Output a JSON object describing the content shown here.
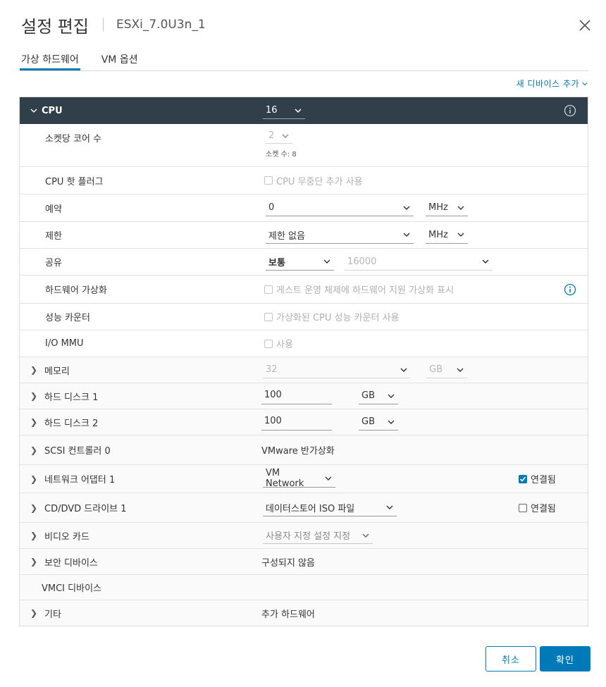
{
  "dialog": {
    "title": "설정 편집",
    "vm_name": "ESXi_7.0U3n_1"
  },
  "tabs": [
    {
      "label": "가상 하드웨어",
      "active": true
    },
    {
      "label": "VM 옵션",
      "active": false
    }
  ],
  "add_device": "새 디바이스 추가",
  "cpu": {
    "label": "CPU",
    "value": "16",
    "cores_per_socket": {
      "label": "소켓당 코어 수",
      "value": "2",
      "sockets_text": "소켓 수: 8"
    },
    "hot_plug": {
      "label": "CPU 핫 플러그",
      "checkbox": "CPU 무중단 추가 사용"
    },
    "reservation": {
      "label": "예약",
      "value": "0",
      "unit": "MHz"
    },
    "limit": {
      "label": "제한",
      "value": "제한 없음",
      "unit": "MHz"
    },
    "shares": {
      "label": "공유",
      "level": "보통",
      "value": "16000"
    },
    "hw_virt": {
      "label": "하드웨어 가상화",
      "checkbox": "게스트 운영 체제에 하드웨어 지원 가상화 표시"
    },
    "perf_counters": {
      "label": "성능 카운터",
      "checkbox": "가상화된 CPU 성능 카운터 사용"
    },
    "iommu": {
      "label": "I/O MMU",
      "checkbox": "사용"
    }
  },
  "memory": {
    "label": "메모리",
    "value": "32",
    "unit": "GB"
  },
  "disk1": {
    "label": "하드 디스크 1",
    "value": "100",
    "unit": "GB"
  },
  "disk2": {
    "label": "하드 디스크 2",
    "value": "100",
    "unit": "GB"
  },
  "scsi": {
    "label": "SCSI 컨트롤러 0",
    "value": "VMware 반가상화"
  },
  "network": {
    "label": "네트워크 어댑터 1",
    "value": "VM Network",
    "connected_label": "연결됨",
    "connected": true
  },
  "cdrom": {
    "label": "CD/DVD 드라이브 1",
    "value": "데이터스토어 ISO 파일",
    "connected_label": "연결됨",
    "connected": false
  },
  "video": {
    "label": "비디오 카드",
    "value": "사용자 지정 설정 지정"
  },
  "security": {
    "label": "보안 디바이스",
    "value": "구성되지 않음"
  },
  "vmci": {
    "label": "VMCI 디바이스"
  },
  "other": {
    "label": "기타",
    "value": "추가 하드웨어"
  },
  "buttons": {
    "cancel": "취소",
    "ok": "확인"
  },
  "colors": {
    "accent": "#0079b8",
    "header_bg": "#313f4a"
  }
}
